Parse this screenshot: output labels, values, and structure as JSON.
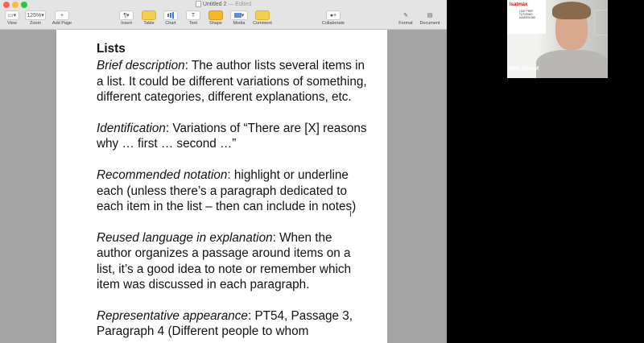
{
  "window": {
    "title": "Untitled 2",
    "edited": "— Edited"
  },
  "toolbar": {
    "view": "View",
    "zoom": "Zoom",
    "zoom_value": "125%",
    "add_page": "Add Page",
    "insert": "Insert",
    "table": "Table",
    "chart": "Chart",
    "text": "Text",
    "shape": "Shape",
    "media": "Media",
    "comment": "Comment",
    "collaborate": "Collaborate",
    "format": "Format",
    "document": "Document"
  },
  "document": {
    "heading": "Lists",
    "paragraphs": [
      {
        "label": "Brief description",
        "text": ": The author lists several items in a list. It could be different variations of something, different categories, different explanations, etc."
      },
      {
        "label": "Identification",
        "text": ": Variations of “There are [X] reasons why … first … second …”"
      },
      {
        "label": "Recommended notation",
        "text": ": highlight or underline each (unless there’s a paragraph dedicated to each item in the list – then can include in notes)"
      },
      {
        "label": "Reused language in explanation",
        "text": ": When the author organizes a passage around items on a list, it’s a good idea to note or remember which item was discussed in each paragraph."
      },
      {
        "label": "Representative appearance",
        "text": ": PT54, Passage 3, Paragraph 4 (Different people to whom"
      }
    ]
  },
  "webcam": {
    "name": "Rob Smoot",
    "logo": "lsatmax",
    "logo_sub": "LSAT PREP TUTORING ADMISSIONS"
  },
  "colors": {
    "close": "#fe5f57",
    "minimize": "#febc2e",
    "zoom": "#28c840",
    "insert_icon": "#f4b82a",
    "chart_icon": "#3a7bd5"
  }
}
